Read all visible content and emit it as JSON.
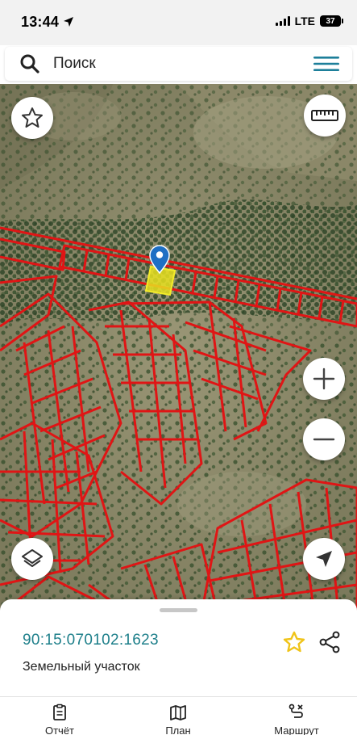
{
  "status": {
    "time": "13:44",
    "network": "LTE",
    "battery": "37"
  },
  "search": {
    "placeholder": "Поиск"
  },
  "map": {
    "selected_parcel_color": "#e8e020",
    "parcel_border_color": "#e01515",
    "pin_color": "#1e6fc4"
  },
  "parcel": {
    "number": "90:15:070102:1623",
    "type": "Земельный участок",
    "favorite_color": "#f0c419"
  },
  "tabs": [
    {
      "label": "Отчёт",
      "icon": "clipboard-icon"
    },
    {
      "label": "План",
      "icon": "map-icon"
    },
    {
      "label": "Маршрут",
      "icon": "route-icon"
    }
  ]
}
